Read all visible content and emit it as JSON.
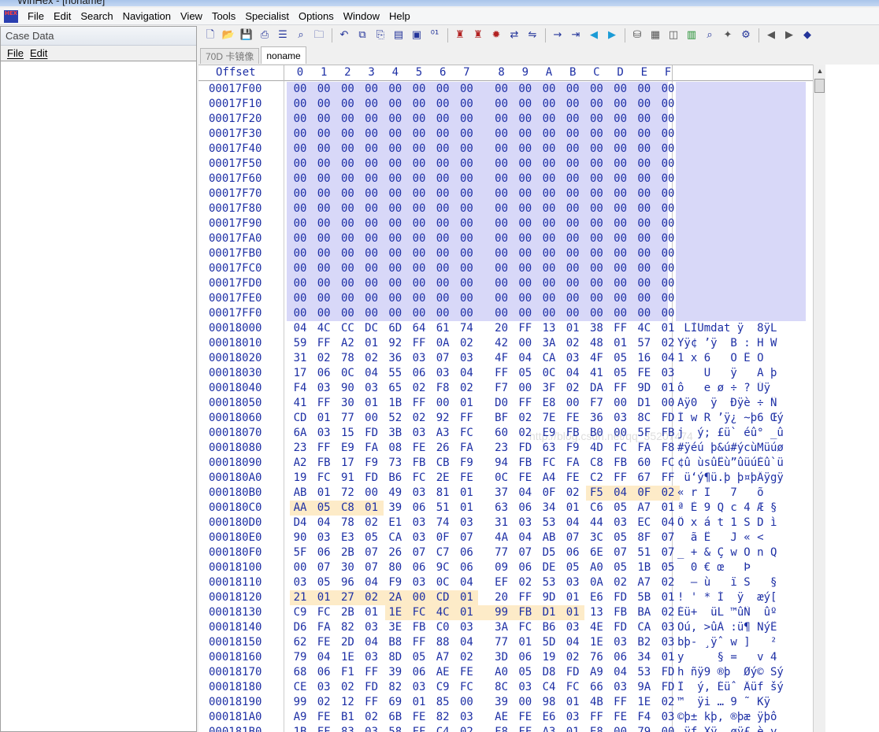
{
  "window": {
    "title": "WinHex - [noname]"
  },
  "menu": [
    "File",
    "Edit",
    "Search",
    "Navigation",
    "View",
    "Tools",
    "Specialist",
    "Options",
    "Window",
    "Help"
  ],
  "app_icon_text": "HEX",
  "case_panel": {
    "title": "Case Data",
    "menu": [
      "File",
      "Edit"
    ]
  },
  "toolbar": {
    "icons": [
      "new-file-icon",
      "open-file-icon",
      "save-icon",
      "print-icon",
      "properties-icon",
      "find-icon",
      "open-folder-icon",
      "sep",
      "undo-icon",
      "copy-block-icon",
      "paste-icon",
      "clipboard-icon",
      "paste-special-icon",
      "binary-icon",
      "sep",
      "find-text-icon",
      "find-hex-icon",
      "hex-icon",
      "replace-text-icon",
      "replace-hex-icon",
      "sep",
      "goto-icon",
      "goto-offset-icon",
      "back-icon",
      "forward-icon",
      "sep",
      "disk-icon",
      "ram-icon",
      "image-icon",
      "calculator-icon",
      "zoom-icon",
      "hash-icon",
      "gear-icon",
      "sep",
      "prev-icon",
      "next-icon",
      "extra-icon"
    ]
  },
  "tabs": [
    {
      "label": "70D 卡镜像",
      "active": false
    },
    {
      "label": "noname",
      "active": true
    }
  ],
  "hex_header": {
    "offset_label": "Offset",
    "columns": [
      "0",
      "1",
      "2",
      "3",
      "4",
      "5",
      "6",
      "7",
      "8",
      "9",
      "A",
      "B",
      "C",
      "D",
      "E",
      "F"
    ]
  },
  "hex_rows": [
    {
      "offset": "00017F00",
      "bytes": "00 00 00 00 00 00 00 00 00 00 00 00 00 00 00 00",
      "text": ""
    },
    {
      "offset": "00017F10",
      "bytes": "00 00 00 00 00 00 00 00 00 00 00 00 00 00 00 00",
      "text": ""
    },
    {
      "offset": "00017F20",
      "bytes": "00 00 00 00 00 00 00 00 00 00 00 00 00 00 00 00",
      "text": ""
    },
    {
      "offset": "00017F30",
      "bytes": "00 00 00 00 00 00 00 00 00 00 00 00 00 00 00 00",
      "text": ""
    },
    {
      "offset": "00017F40",
      "bytes": "00 00 00 00 00 00 00 00 00 00 00 00 00 00 00 00",
      "text": ""
    },
    {
      "offset": "00017F50",
      "bytes": "00 00 00 00 00 00 00 00 00 00 00 00 00 00 00 00",
      "text": ""
    },
    {
      "offset": "00017F60",
      "bytes": "00 00 00 00 00 00 00 00 00 00 00 00 00 00 00 00",
      "text": ""
    },
    {
      "offset": "00017F70",
      "bytes": "00 00 00 00 00 00 00 00 00 00 00 00 00 00 00 00",
      "text": ""
    },
    {
      "offset": "00017F80",
      "bytes": "00 00 00 00 00 00 00 00 00 00 00 00 00 00 00 00",
      "text": ""
    },
    {
      "offset": "00017F90",
      "bytes": "00 00 00 00 00 00 00 00 00 00 00 00 00 00 00 00",
      "text": ""
    },
    {
      "offset": "00017FA0",
      "bytes": "00 00 00 00 00 00 00 00 00 00 00 00 00 00 00 00",
      "text": ""
    },
    {
      "offset": "00017FB0",
      "bytes": "00 00 00 00 00 00 00 00 00 00 00 00 00 00 00 00",
      "text": ""
    },
    {
      "offset": "00017FC0",
      "bytes": "00 00 00 00 00 00 00 00 00 00 00 00 00 00 00 00",
      "text": ""
    },
    {
      "offset": "00017FD0",
      "bytes": "00 00 00 00 00 00 00 00 00 00 00 00 00 00 00 00",
      "text": ""
    },
    {
      "offset": "00017FE0",
      "bytes": "00 00 00 00 00 00 00 00 00 00 00 00 00 00 00 00",
      "text": ""
    },
    {
      "offset": "00017FF0",
      "bytes": "00 00 00 00 00 00 00 00 00 00 00 00 00 00 00 00",
      "text": ""
    },
    {
      "offset": "00018000",
      "bytes": "04 4C CC DC 6D 64 61 74 20 FF 13 01 38 FF 4C 01",
      "text": " LÌÜmdat ÿ  8ÿL "
    },
    {
      "offset": "00018010",
      "bytes": "59 FF A2 01 92 FF 0A 02 42 00 3A 02 48 01 57 02",
      "text": "Yÿ¢ ’ÿ  B : H W "
    },
    {
      "offset": "00018020",
      "bytes": "31 02 78 02 36 03 07 03 4F 04 CA 03 4F 05 16 04",
      "text": "1 x 6   O Ê O   "
    },
    {
      "offset": "00018030",
      "bytes": "17 06 0C 04 55 06 03 04 FF 05 0C 04 41 05 FE 03",
      "text": "    U   ÿ   A þ "
    },
    {
      "offset": "00018040",
      "bytes": "F4 03 90 03 65 02 F8 02 F7 00 3F 02 DA FF 9D 01",
      "text": "ô   e ø ÷ ? Úÿ  "
    },
    {
      "offset": "00018050",
      "bytes": "41 FF 30 01 1B FF 00 01 D0 FF E8 00 F7 00 D1 00",
      "text": "Aÿ0  ÿ  Ðÿè ÷ Ñ "
    },
    {
      "offset": "00018060",
      "bytes": "CD 01 77 00 52 02 92 FF BF 02 7E FE 36 03 8C FD",
      "text": "Í w R ’ÿ¿ ~þ6 Œý"
    },
    {
      "offset": "00018070",
      "bytes": "6A 03 15 FD 3B 03 A3 FC 60 02 E9 FB B0 00 5F FB",
      "text": "j  ý; £ü` éû° _û"
    },
    {
      "offset": "00018080",
      "bytes": "23 FF E9 FA 08 FE 26 FA 23 FD 63 F9 4D FC FA F8",
      "text": "#ÿéú þ&ú#ýcùMüúø"
    },
    {
      "offset": "00018090",
      "bytes": "A2 FB 17 F9 73 FB CB F9 94 FB FC FA C8 FB 60 FC",
      "text": "¢û ùsûËù”ûüúÈû`ü"
    },
    {
      "offset": "000180A0",
      "bytes": "19 FC 91 FD B6 FC 2E FE 0C FE A4 FE C2 FF 67 FF",
      "text": " ü‘ý¶ü.þ þ¤þÂÿgÿ"
    },
    {
      "offset": "000180B0",
      "bytes": "AB 01 72 00 49 03 81 01 37 04 0F 02 F5 04 0F 02",
      "text": "« r I   7   õ   "
    },
    {
      "offset": "000180C0",
      "bytes": "AA 05 C8 01 39 06 51 01 63 06 34 01 C6 05 A7 01",
      "text": "ª È 9 Q c 4 Æ § "
    },
    {
      "offset": "000180D0",
      "bytes": "D4 04 78 02 E1 03 74 03 31 03 53 04 44 03 EC 04",
      "text": "Ô x á t 1 S D ì "
    },
    {
      "offset": "000180E0",
      "bytes": "90 03 E3 05 CA 03 0F 07 4A 04 AB 07 3C 05 8F 07",
      "text": "  ã Ê   J « <   "
    },
    {
      "offset": "000180F0",
      "bytes": "5F 06 2B 07 26 07 C7 06 77 07 D5 06 6E 07 51 07",
      "text": "_ + & Ç w Õ n Q "
    },
    {
      "offset": "00018100",
      "bytes": "00 07 30 07 80 06 9C 06 09 06 DE 05 A0 05 1B 05",
      "text": "  0 € œ   Þ     "
    },
    {
      "offset": "00018110",
      "bytes": "03 05 96 04 F9 03 0C 04 EF 02 53 03 0A 02 A7 02",
      "text": "  – ù   ï S   § "
    },
    {
      "offset": "00018120",
      "bytes": "21 01 27 02 2A 00 CD 01 20 FF 9D 01 E6 FD 5B 01",
      "text": "! ' * Í  ÿ  æý[ "
    },
    {
      "offset": "00018130",
      "bytes": "C9 FC 2B 01 1E FC 4C 01 99 FB D1 01 13 FB BA 02",
      "text": "Éü+  üL ™ûÑ  ûº "
    },
    {
      "offset": "00018140",
      "bytes": "D6 FA 82 03 3E FB C0 03 3A FC B6 03 4E FD CA 03",
      "text": "Öú‚ >ûÀ :ü¶ NýÊ "
    },
    {
      "offset": "00018150",
      "bytes": "62 FE 2D 04 B8 FF 88 04 77 01 5D 04 1E 03 B2 03",
      "text": "bþ- ¸ÿˆ w ]   ² "
    },
    {
      "offset": "00018160",
      "bytes": "79 04 1E 03 8D 05 A7 02 3D 06 19 02 76 06 34 01",
      "text": "y     § =   v 4 "
    },
    {
      "offset": "00018170",
      "bytes": "68 06 F1 FF 39 06 AE FE A0 05 D8 FD A9 04 53 FD",
      "text": "h ñÿ9 ®þ  Øý© Sý"
    },
    {
      "offset": "00018180",
      "bytes": "CE 03 02 FD 82 03 C9 FC 8C 03 C4 FC 66 03 9A FD",
      "text": "Î  ý‚ Éüˆ Äüf šý"
    },
    {
      "offset": "00018190",
      "bytes": "99 02 12 FF 69 01 85 00 39 00 98 01 4B FF 1E 02",
      "text": "™  ÿi … 9 ˜ Kÿ  "
    },
    {
      "offset": "000181A0",
      "bytes": "A9 FE B1 02 6B FE 82 03 AE FE E6 03 FF FE F4 03",
      "text": "©þ± kþ‚ ®þæ ÿþô "
    },
    {
      "offset": "000181B0",
      "bytes": "1B FF 83 03 58 FF C4 02 F8 FF A3 01 E8 00 79 00",
      "text": " ÿƒ Xÿ  øÿ£ è y "
    }
  ],
  "highlights": [
    {
      "row": 27,
      "start": 12,
      "end": 15
    },
    {
      "row": 28,
      "start": 0,
      "end": 3
    },
    {
      "row": 34,
      "start": 0,
      "end": 7
    },
    {
      "row": 35,
      "start": 4,
      "end": 11
    }
  ],
  "watermark": "http://blog.csdn.net/qq_35207474"
}
